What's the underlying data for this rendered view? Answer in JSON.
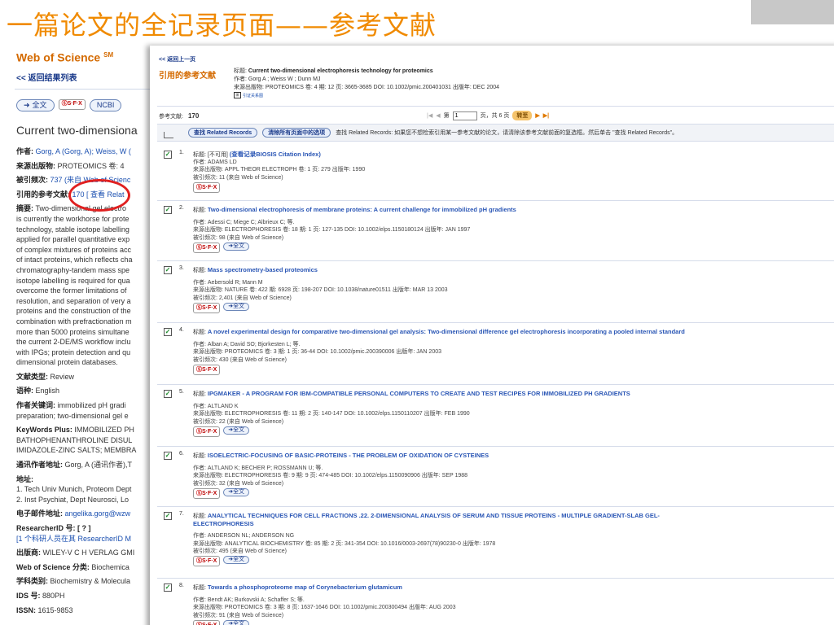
{
  "slide": {
    "title": "一篇论文的全记录页面——参考文献"
  },
  "background_page": {
    "logo": "Web of Science",
    "logo_sup": "SM",
    "back_link": "<< 返回结果列表",
    "btn_fulltext": "全文",
    "btn_sfx": "S·F·X",
    "btn_ncbi": "NCBI",
    "article_title": "Current two-dimensiona",
    "author_label": "作者: ",
    "author_value": "Gorg, A (Gorg, A); Weiss, W (",
    "source_label": "来源出版物: ",
    "source_value": "PROTEOMICS 卷: 4",
    "cited_label": "被引频次: ",
    "cited_value": "737 (来自 Web of Scienc",
    "refs_label": "引用的参考文献: ",
    "refs_value": "170 [ 查看  Relat",
    "abstract_label": "摘要: ",
    "abstract_lines": [
      "Two-dimensional gel electro",
      "is currently the workhorse for prote",
      "technology, stable isotope labelling",
      "applied for parallel quantitative exp",
      "of complex mixtures of proteins acc",
      "of intact proteins, which reflects cha",
      "chromatography-tandem mass spe",
      "isotope labelling is required for qua",
      "overcome the former limitations of",
      "resolution, and separation of very a",
      "proteins and the construction of the",
      "combination with prefractionation m",
      "more than 5000 proteins simultane",
      "the current 2-DE/MS workflow inclu",
      "with IPGs; protein detection and qu",
      "dimensional protein databases."
    ],
    "doctype_label": "文献类型: ",
    "doctype_value": "Review",
    "lang_label": "语种: ",
    "lang_value": "English",
    "keywords_label": "作者关键词: ",
    "keywords_lines": [
      "immobilized pH gradi",
      "preparation; two-dimensional gel e"
    ],
    "kwplus_label": "KeyWords Plus: ",
    "kwplus_lines": [
      "IMMOBILIZED PH",
      "BATHOPHENANTHROLINE DISUL",
      "IMIDAZOLE-ZINC SALTS; MEMBRA"
    ],
    "corr_label": "通讯作者地址: ",
    "corr_value": "Gorg, A (通讯作者),T",
    "addr_label": "地址:",
    "addr_lines": [
      "1. Tech Univ Munich, Proteom Dept",
      "2. Inst Psychiat, Dept Neurosci, Lo"
    ],
    "email_label": "电子邮件地址: ",
    "email_value": "angelika.gorg@wzw",
    "rid_label": "ResearcherID 号: ",
    "rid_value": "[ ? ]",
    "rid_line": "[1 个科研人员在其  ResearcherID M",
    "pub_label": "出版商: ",
    "pub_value": "WILEY-V C H VERLAG GMI",
    "wos_cat_label": "Web of Science 分类: ",
    "wos_cat_value": "Biochemica",
    "subj_label": "学科类别: ",
    "subj_value": "Biochemistry & Molecula",
    "ids_label": "IDS 号: ",
    "ids_value": "880PH",
    "issn_label": "ISSN: ",
    "issn_value": "1615-9853"
  },
  "refs_window": {
    "back": "<< 返回上一页",
    "heading": "引用的参考文献",
    "src_title_label": "标题: ",
    "src_title": "Current two-dimensional electrophoresis technology for proteomics",
    "src_author": "作者: Gorg A ; Weiss W ; Dunn MJ",
    "src_source": "来源出版物: PROTEOMICS 卷: 4  期: 12  页: 3665-3685  DOI: 10.1002/pmic.200401031  出版年: DEC 2004",
    "src_icon_label": "引证关系图",
    "count_label": "参考文献:",
    "count_value": "170",
    "page_label": "第",
    "page_value": "1",
    "page_total": "页，共 6 页",
    "go_label": "转至",
    "btn_related": "查找 Related Records",
    "btn_clear": "清除所有页面中的选项",
    "hint": "查找 Related Records: 如果您不想检索引用某一参考文献的论文，请清除该参考文献前面的复选框。然后单击 \"查找 Related Records\"。",
    "sfx_label": "S·F·X",
    "fulltext_label": "全文",
    "records": [
      {
        "num": "1.",
        "title_label": "标题: ",
        "title": "[不可用]",
        "title_extra": "(查看记录BIOSIS Citation Index)",
        "author": "作者: ADAMS LD",
        "source": "来源出版物: APPL THEOR ELECTROPH  卷: 1  页: 279  出版年: 1990",
        "cited": "被引频次: 11 (来自 Web of Science)"
      },
      {
        "num": "2.",
        "title_label": "标题: ",
        "title": "Two-dimensional electrophoresis of membrane proteins: A current challenge for immobilized pH gradients",
        "title_extra": "",
        "author": "作者: Adessi C; Miege C; Albrieux C; 等.",
        "source": "来源出版物: ELECTROPHORESIS  卷: 18  期: 1  页: 127-135  DOI: 10.1002/elps.1150180124  出版年: JAN 1997",
        "cited": "被引频次: 98 (来自 Web of Science)"
      },
      {
        "num": "3.",
        "title_label": "标题: ",
        "title": "Mass spectrometry-based proteomics",
        "title_extra": "",
        "author": "作者: Aebersold R; Mann M",
        "source": "来源出版物: NATURE  卷: 422  期: 6928  页: 198-207  DOI: 10.1038/nature01511  出版年: MAR 13 2003",
        "cited": "被引频次: 2,401 (来自 Web of Science)"
      },
      {
        "num": "4.",
        "title_label": "标题: ",
        "title": "A novel experimental design for comparative two-dimensional gel analysis: Two-dimensional difference gel electrophoresis incorporating a pooled internal standard",
        "title_extra": "",
        "author": "作者: Alban A; David SO; Bjorkesten L; 等.",
        "source": "来源出版物: PROTEOMICS  卷: 3  期: 1  页: 36-44  DOI: 10.1002/pmic.200390006  出版年: JAN 2003",
        "cited": "被引频次: 430 (来自 Web of Science)"
      },
      {
        "num": "5.",
        "title_label": "标题: ",
        "title": "IPGMAKER - A PROGRAM FOR IBM-COMPATIBLE PERSONAL COMPUTERS TO CREATE AND TEST RECIPES FOR IMMOBILIZED PH GRADIENTS",
        "title_extra": "",
        "author": "作者: ALTLAND K",
        "source": "来源出版物: ELECTROPHORESIS  卷: 11  期: 2  页: 140-147  DOI: 10.1002/elps.1150110207  出版年: FEB 1990",
        "cited": "被引频次: 22 (来自 Web of Science)"
      },
      {
        "num": "6.",
        "title_label": "标题: ",
        "title": "ISOELECTRIC-FOCUSING OF BASIC-PROTEINS - THE PROBLEM OF OXIDATION OF CYSTEINES",
        "title_extra": "",
        "author": "作者: ALTLAND K; BECHER P; ROSSMANN U; 等.",
        "source": "来源出版物: ELECTROPHORESIS  卷: 9  期: 9  页: 474-485  DOI: 10.1002/elps.1150090906  出版年: SEP 1988",
        "cited": "被引频次: 32 (来自 Web of Science)"
      },
      {
        "num": "7.",
        "title_label": "标题: ",
        "title": "ANALYTICAL TECHNIQUES FOR CELL FRACTIONS .22. 2-DIMENSIONAL ANALYSIS OF SERUM AND TISSUE PROTEINS - MULTIPLE GRADIENT-SLAB GEL-",
        "title2": "ELECTROPHORESIS",
        "title_extra": "",
        "author": "作者: ANDERSON NL; ANDERSON NG",
        "source": "来源出版物: ANALYTICAL BIOCHEMISTRY  卷: 85  期: 2  页: 341-354  DOI: 10.1016/0003-2697(78)90230-0  出版年: 1978",
        "cited": "被引频次: 495 (来自 Web of Science)"
      },
      {
        "num": "8.",
        "title_label": "标题: ",
        "title": "Towards a phosphoproteome map of Corynebacterium glutamicum",
        "title_extra": "",
        "author": "作者: Bendt AK; Burkovski A; Schaffer S; 等.",
        "source": "来源出版物: PROTEOMICS  卷: 3  期: 8  页: 1637-1646  DOI: 10.1002/pmic.200300494  出版年: AUG 2003",
        "cited": "被引频次: 91 (来自 Web of Science)"
      }
    ]
  }
}
